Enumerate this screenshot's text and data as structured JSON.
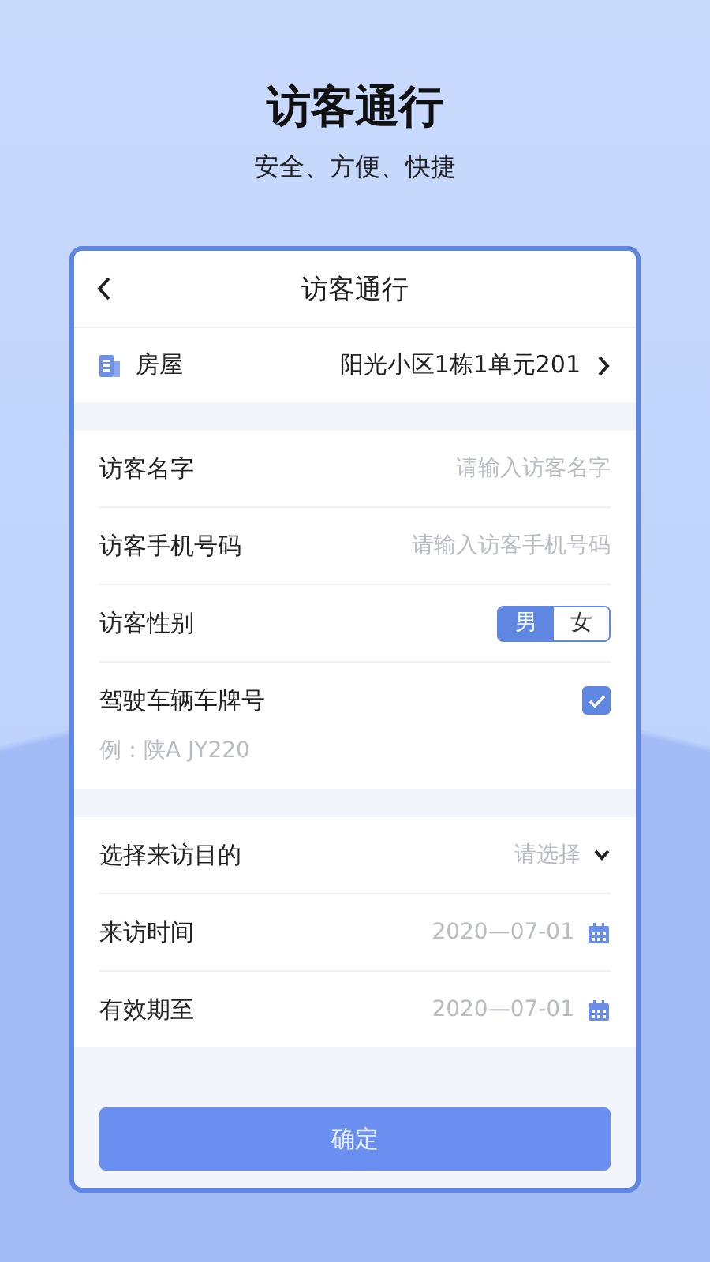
{
  "hero": {
    "title": "访客通行",
    "subtitle": "安全、方便、快捷"
  },
  "card": {
    "title": "访客通行",
    "house": {
      "label": "房屋",
      "value": "阳光小区1栋1单元201"
    },
    "sections": [
      {
        "fields": [
          {
            "kind": "text",
            "label": "访客名字",
            "placeholder": "请输入访客名字"
          },
          {
            "kind": "text",
            "label": "访客手机号码",
            "placeholder": "请输入访客手机号码"
          },
          {
            "kind": "gender",
            "label": "访客性别",
            "options": [
              {
                "label": "男",
                "selected": true
              },
              {
                "label": "女",
                "selected": false
              }
            ]
          },
          {
            "kind": "plate",
            "label": "驾驶车辆车牌号",
            "checked": true,
            "placeholder": "例：陕A JY220"
          }
        ]
      },
      {
        "fields": [
          {
            "kind": "select",
            "label": "选择来访目的",
            "placeholder": "请选择"
          },
          {
            "kind": "date",
            "label": "来访时间",
            "placeholder": "2020—07-01"
          },
          {
            "kind": "date",
            "label": "有效期至",
            "placeholder": "2020—07-01"
          }
        ]
      }
    ],
    "submit": "确定"
  }
}
